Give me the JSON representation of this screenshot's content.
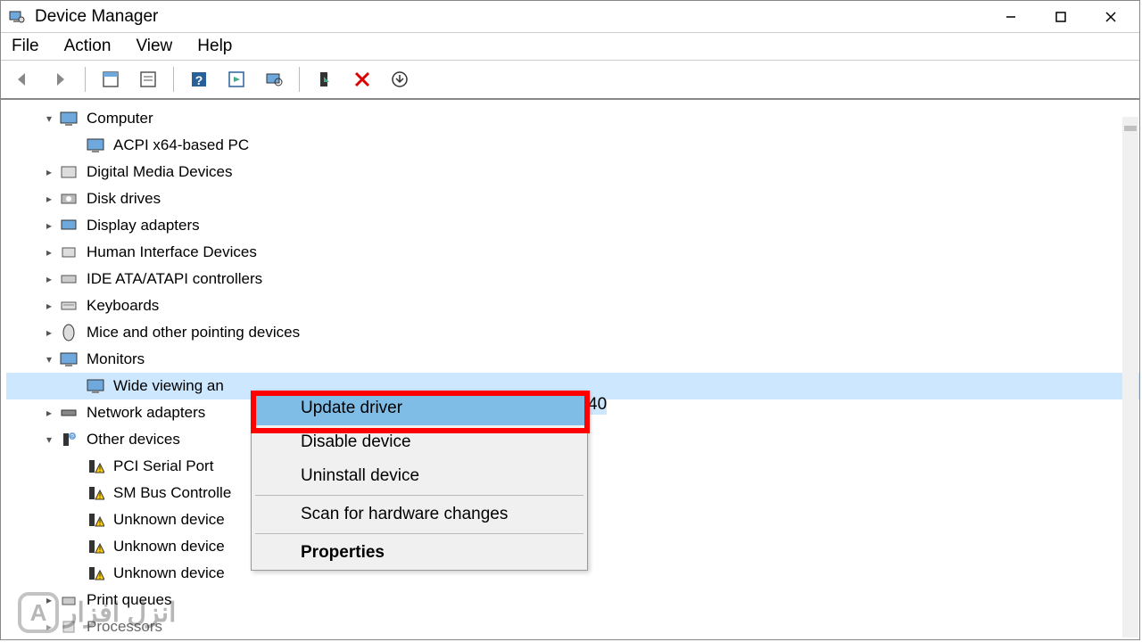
{
  "title": "Device Manager",
  "menus": {
    "file": "File",
    "action": "Action",
    "view": "View",
    "help": "Help"
  },
  "tree": {
    "computer": "Computer",
    "acpi": "ACPI x64-based PC",
    "dmd": "Digital Media Devices",
    "disk": "Disk drives",
    "display": "Display adapters",
    "hid": "Human Interface Devices",
    "ide": "IDE ATA/ATAPI controllers",
    "keyboards": "Keyboards",
    "mice": "Mice and other pointing devices",
    "monitors": "Monitors",
    "monitor_item": "Wide viewing an",
    "monitor_tail": "40",
    "net": "Network adapters",
    "other": "Other devices",
    "pci": "PCI Serial Port",
    "smbus": "SM Bus Controlle",
    "unk1": "Unknown device",
    "unk2": "Unknown device",
    "unk3": "Unknown device",
    "printq": "Print queues",
    "proc": "Processors"
  },
  "context": {
    "update": "Update driver",
    "disable": "Disable device",
    "uninstall": "Uninstall device",
    "scan": "Scan for hardware changes",
    "props": "Properties"
  },
  "watermark": "انزل افزار"
}
